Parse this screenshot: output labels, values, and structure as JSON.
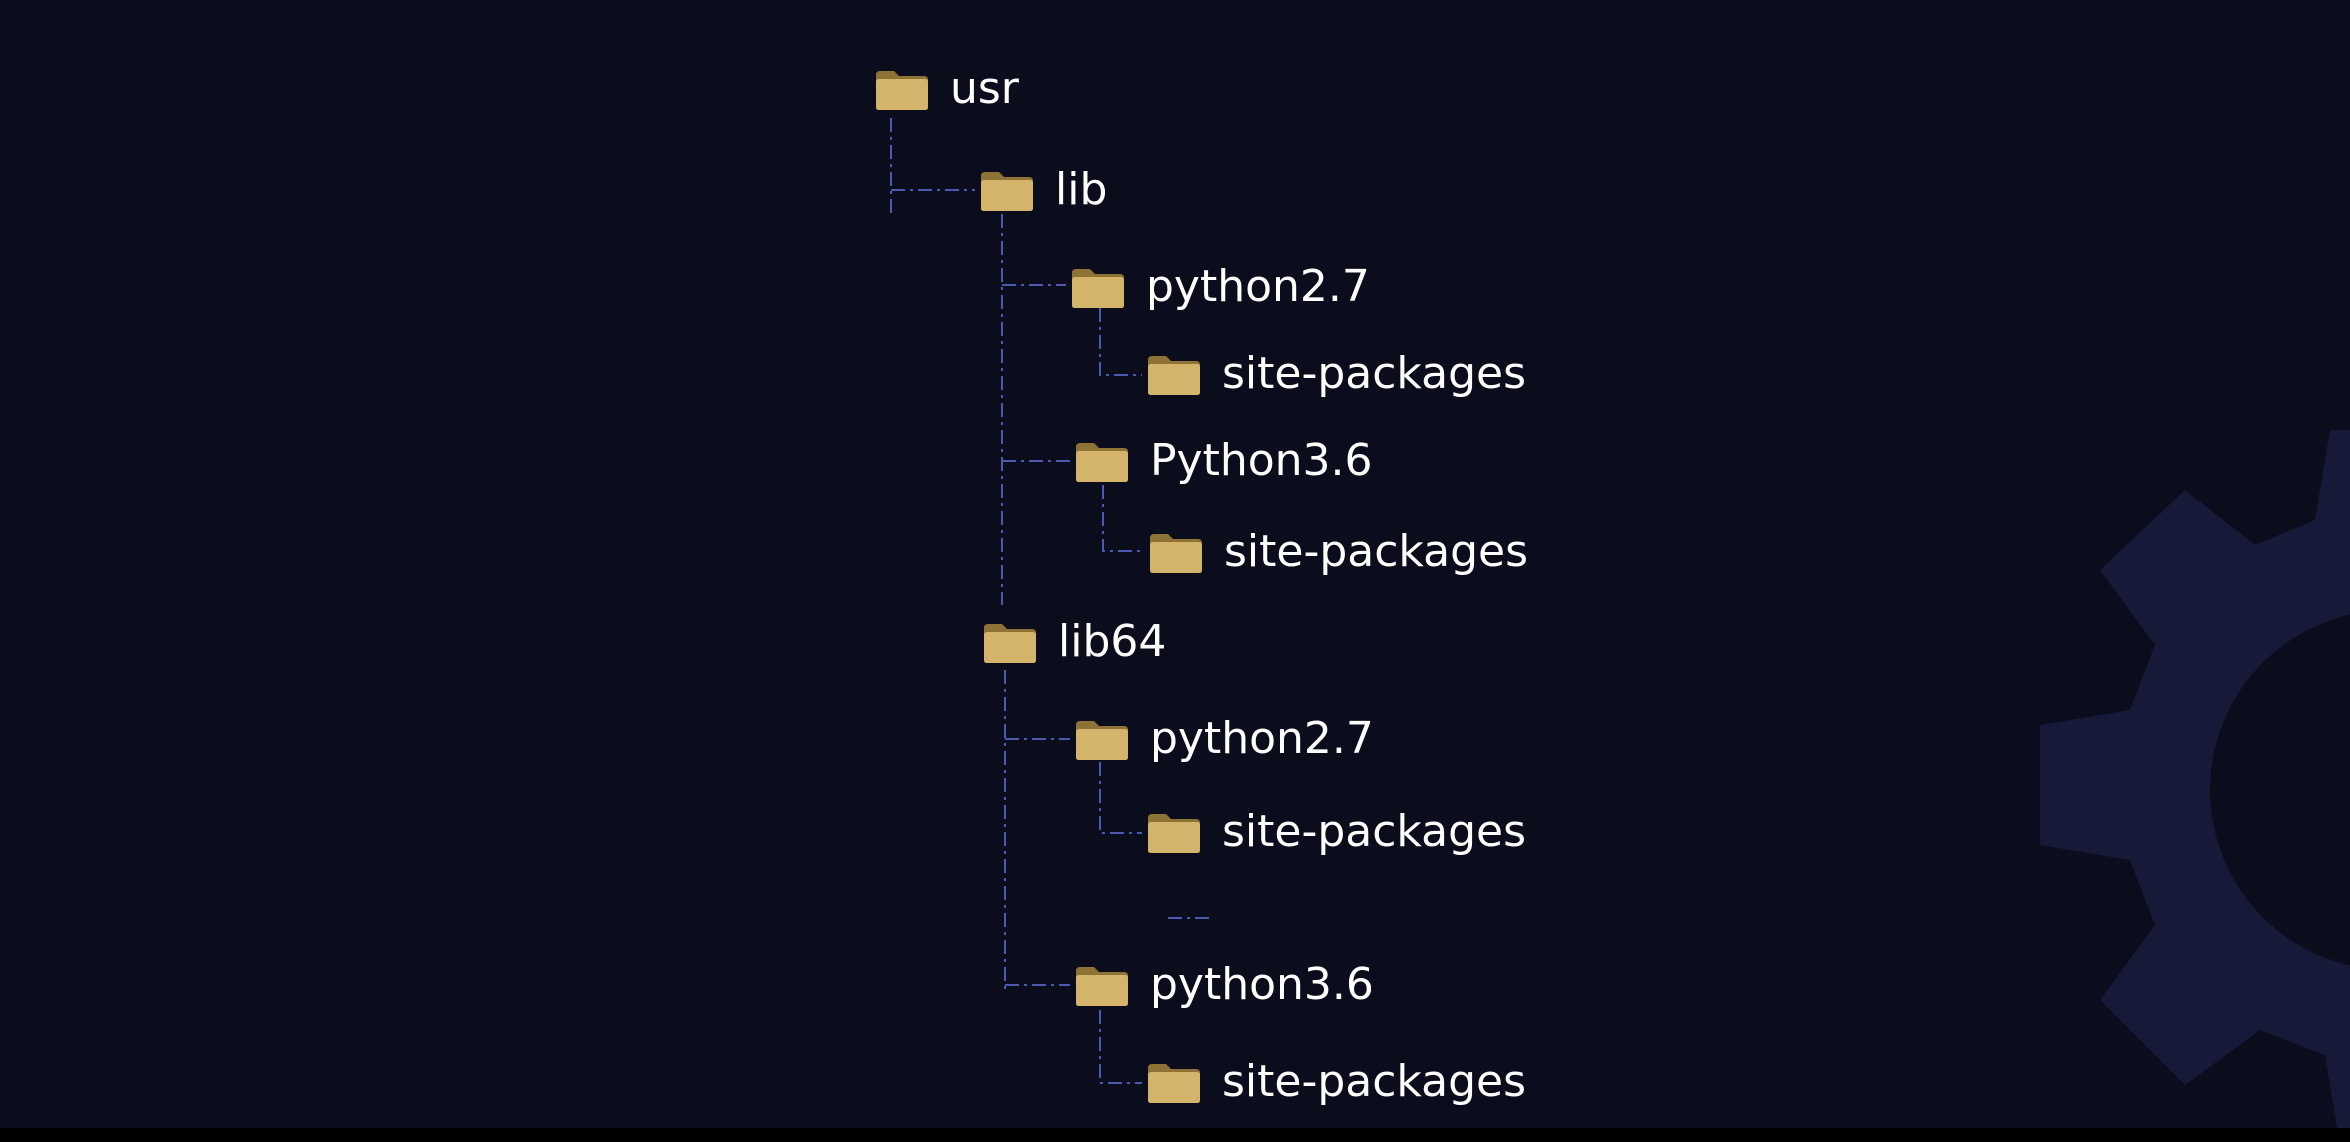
{
  "tree": {
    "usr": "usr",
    "lib": "lib",
    "lib_python27": "python2.7",
    "lib_python27_site": "site-packages",
    "lib_python36": "Python3.6",
    "lib_python36_site": "site-packages",
    "lib64": "lib64",
    "lib64_python27": "python2.7",
    "lib64_python27_site": "site-packages",
    "lib64_python36": "python3.6",
    "lib64_python36_site": "site-packages"
  },
  "colors": {
    "background": "#0b0d1c",
    "connector": "#4a5ab0",
    "folder": "#d4b46a",
    "label": "#ffffff",
    "gear": "#161a38"
  },
  "icons": {
    "folder": "folder-icon",
    "background_gear": "gear-icon"
  }
}
